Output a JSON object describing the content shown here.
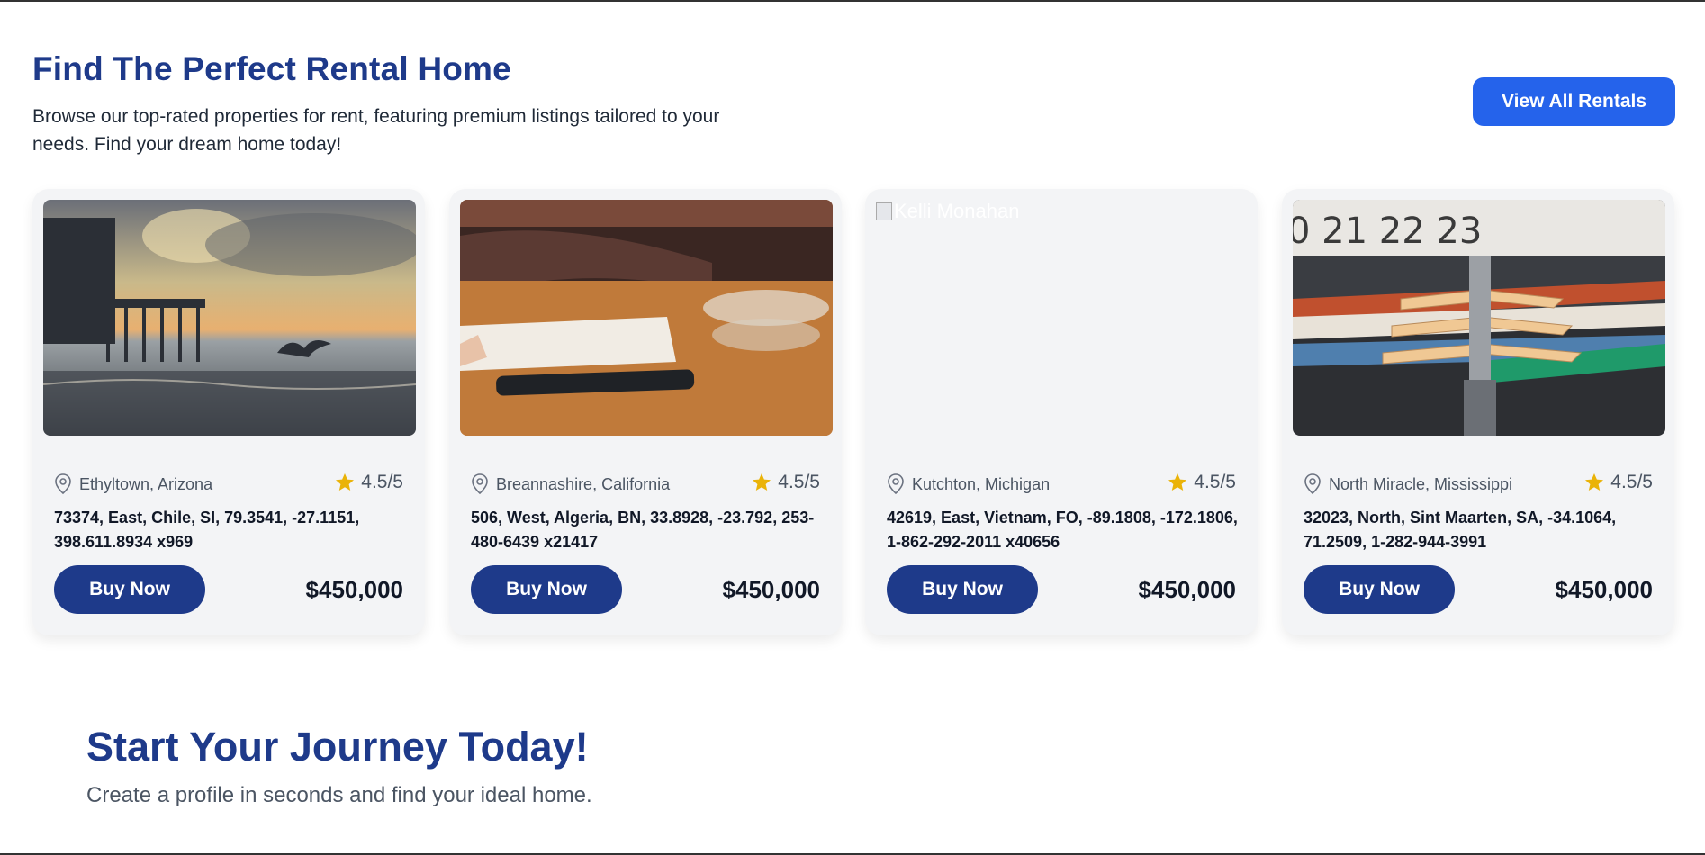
{
  "header": {
    "title": "Find The Perfect Rental Home",
    "subtitle": "Browse our top-rated properties for rent, featuring premium listings tailored to your needs. Find your dream home today!",
    "view_all_label": "View All Rentals"
  },
  "colors": {
    "title": "#1e3a8a",
    "primary_button": "#2563eb",
    "buy_button": "#1e3a8a",
    "star": "#eab308",
    "card_bg": "#f3f4f6"
  },
  "listings": [
    {
      "image": "pier-sunset-photo",
      "location": "Ethyltown, Arizona",
      "rating": "4.5/5",
      "address": "73374, East, Chile, SI, 79.3541, -27.1151, 398.611.8934 x969",
      "buy_label": "Buy Now",
      "price": "$450,000"
    },
    {
      "image": "desk-notebook-photo",
      "location": "Breannashire, California",
      "rating": "4.5/5",
      "address": "506, West, Algeria, BN, 33.8928, -23.792, 253-480-6439 x21417",
      "buy_label": "Buy Now",
      "price": "$450,000"
    },
    {
      "image": "broken-image",
      "image_alt": "Kelli Monahan",
      "location": "Kutchton, Michigan",
      "rating": "4.5/5",
      "address": "42619, East, Vietnam, FO, -89.1808, -172.1806, 1-862-292-2011 x40656",
      "buy_label": "Buy Now",
      "price": "$450,000"
    },
    {
      "image": "clothes-hangers-photo",
      "location": "North Miracle, Mississippi",
      "rating": "4.5/5",
      "address": "32023, North, Sint Maarten, SA, -34.1064, 71.2509, 1-282-944-3991",
      "buy_label": "Buy Now",
      "price": "$450,000"
    }
  ],
  "cta": {
    "title": "Start Your Journey Today!",
    "subtitle": "Create a profile in seconds and find your ideal home."
  }
}
